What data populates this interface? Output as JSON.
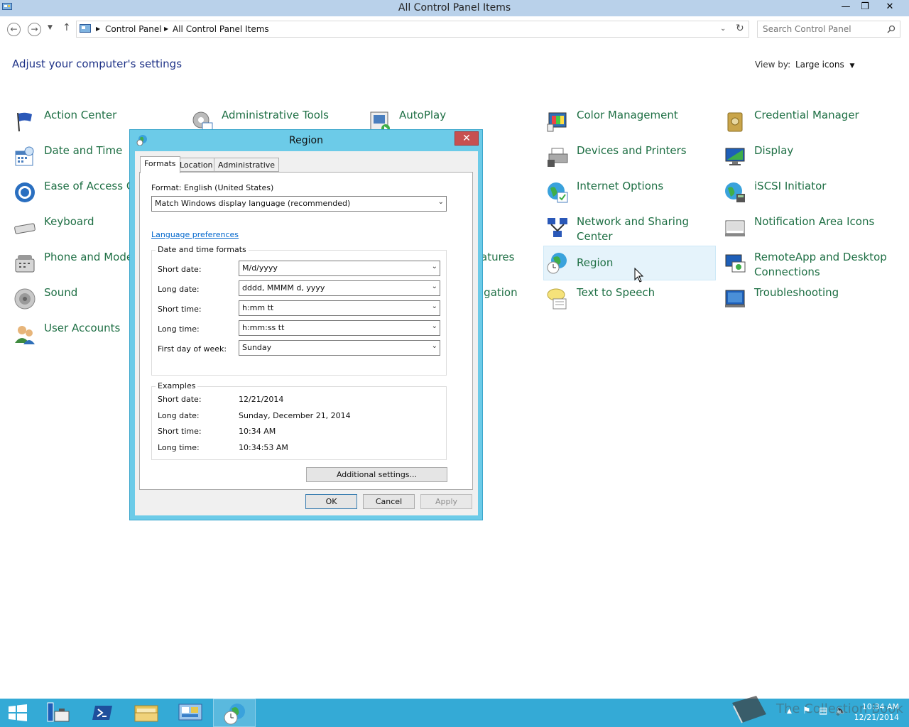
{
  "window": {
    "title": "All Control Panel Items",
    "minimize": "—",
    "restore": "❐",
    "close": "✕"
  },
  "nav": {
    "breadcrumbs": [
      "Control Panel",
      "All Control Panel Items"
    ],
    "search_placeholder": "Search Control Panel"
  },
  "content": {
    "heading": "Adjust your computer's settings",
    "view_by_label": "View by:",
    "view_by_value": "Large icons"
  },
  "items": [
    {
      "label": "Action Center",
      "icon": "flag-icon"
    },
    {
      "label": "Administrative Tools",
      "icon": "admin-tools-icon"
    },
    {
      "label": "AutoPlay",
      "icon": "autoplay-icon"
    },
    {
      "label": "Color Management",
      "icon": "color-management-icon"
    },
    {
      "label": "Credential Manager",
      "icon": "credential-manager-icon"
    },
    {
      "label": "Date and Time",
      "icon": "calendar-icon"
    },
    {
      "label": "Devices and Printers",
      "icon": "printer-icon"
    },
    {
      "label": "Display",
      "icon": "display-icon"
    },
    {
      "label": "Ease of Access Center",
      "icon": "ease-of-access-icon"
    },
    {
      "label": "Internet Options",
      "icon": "internet-options-icon"
    },
    {
      "label": "iSCSI Initiator",
      "icon": "iscsi-icon"
    },
    {
      "label": "Keyboard",
      "icon": "keyboard-icon"
    },
    {
      "label": "Network and Sharing Center",
      "icon": "network-icon"
    },
    {
      "label": "Notification Area Icons",
      "icon": "notification-icon"
    },
    {
      "label": "Phone and Modem",
      "icon": "phone-icon"
    },
    {
      "label": "atures",
      "icon": ""
    },
    {
      "label": "Region",
      "icon": "region-globe-icon"
    },
    {
      "label": "RemoteApp and Desktop Connections",
      "icon": "remoteapp-icon"
    },
    {
      "label": "Sound",
      "icon": "speaker-icon"
    },
    {
      "label": "igation",
      "icon": ""
    },
    {
      "label": "Text to Speech",
      "icon": "speech-icon"
    },
    {
      "label": "Troubleshooting",
      "icon": "troubleshooting-icon"
    },
    {
      "label": "User Accounts",
      "icon": "users-icon"
    }
  ],
  "dialog": {
    "title": "Region",
    "close": "✕",
    "tabs": [
      "Formats",
      "Location",
      "Administrative"
    ],
    "format_label": "Format: English (United States)",
    "format_value": "Match Windows display language (recommended)",
    "language_link": "Language preferences",
    "dt_group_title": "Date and time formats",
    "dt_rows": [
      {
        "label": "Short date:",
        "value": "M/d/yyyy"
      },
      {
        "label": "Long date:",
        "value": "dddd, MMMM d, yyyy"
      },
      {
        "label": "Short time:",
        "value": "h:mm tt"
      },
      {
        "label": "Long time:",
        "value": "h:mm:ss tt"
      },
      {
        "label": "First day of week:",
        "value": "Sunday"
      }
    ],
    "examples_title": "Examples",
    "examples": [
      {
        "label": "Short date:",
        "value": "12/21/2014"
      },
      {
        "label": "Long date:",
        "value": "Sunday, December 21, 2014"
      },
      {
        "label": "Short time:",
        "value": "10:34 AM"
      },
      {
        "label": "Long time:",
        "value": "10:34:53 AM"
      }
    ],
    "additional_settings": "Additional settings...",
    "ok": "OK",
    "cancel": "Cancel",
    "apply": "Apply"
  },
  "taskbar": {
    "clock_time": "10:34 AM",
    "clock_date": "12/21/2014",
    "watermark": "The Collection Book"
  }
}
